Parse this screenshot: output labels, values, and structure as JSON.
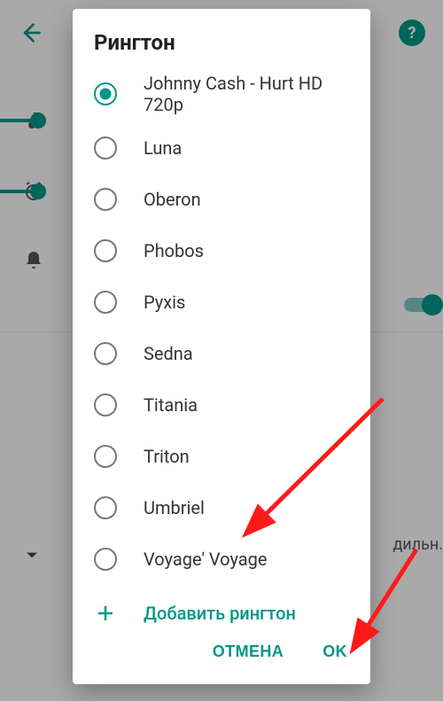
{
  "dialog": {
    "title": "Рингтон",
    "options": [
      {
        "label": "Johnny Cash - Hurt HD 720p",
        "selected": true
      },
      {
        "label": "Luna",
        "selected": false
      },
      {
        "label": "Oberon",
        "selected": false
      },
      {
        "label": "Phobos",
        "selected": false
      },
      {
        "label": "Pyxis",
        "selected": false
      },
      {
        "label": "Sedna",
        "selected": false
      },
      {
        "label": "Titania",
        "selected": false
      },
      {
        "label": "Triton",
        "selected": false
      },
      {
        "label": "Umbriel",
        "selected": false
      },
      {
        "label": "Voyage' Voyage",
        "selected": false
      }
    ],
    "add_label": "Добавить рингтон",
    "cancel": "ОТМЕНА",
    "ok": "OK"
  },
  "background": {
    "tail_text": "дильн."
  }
}
